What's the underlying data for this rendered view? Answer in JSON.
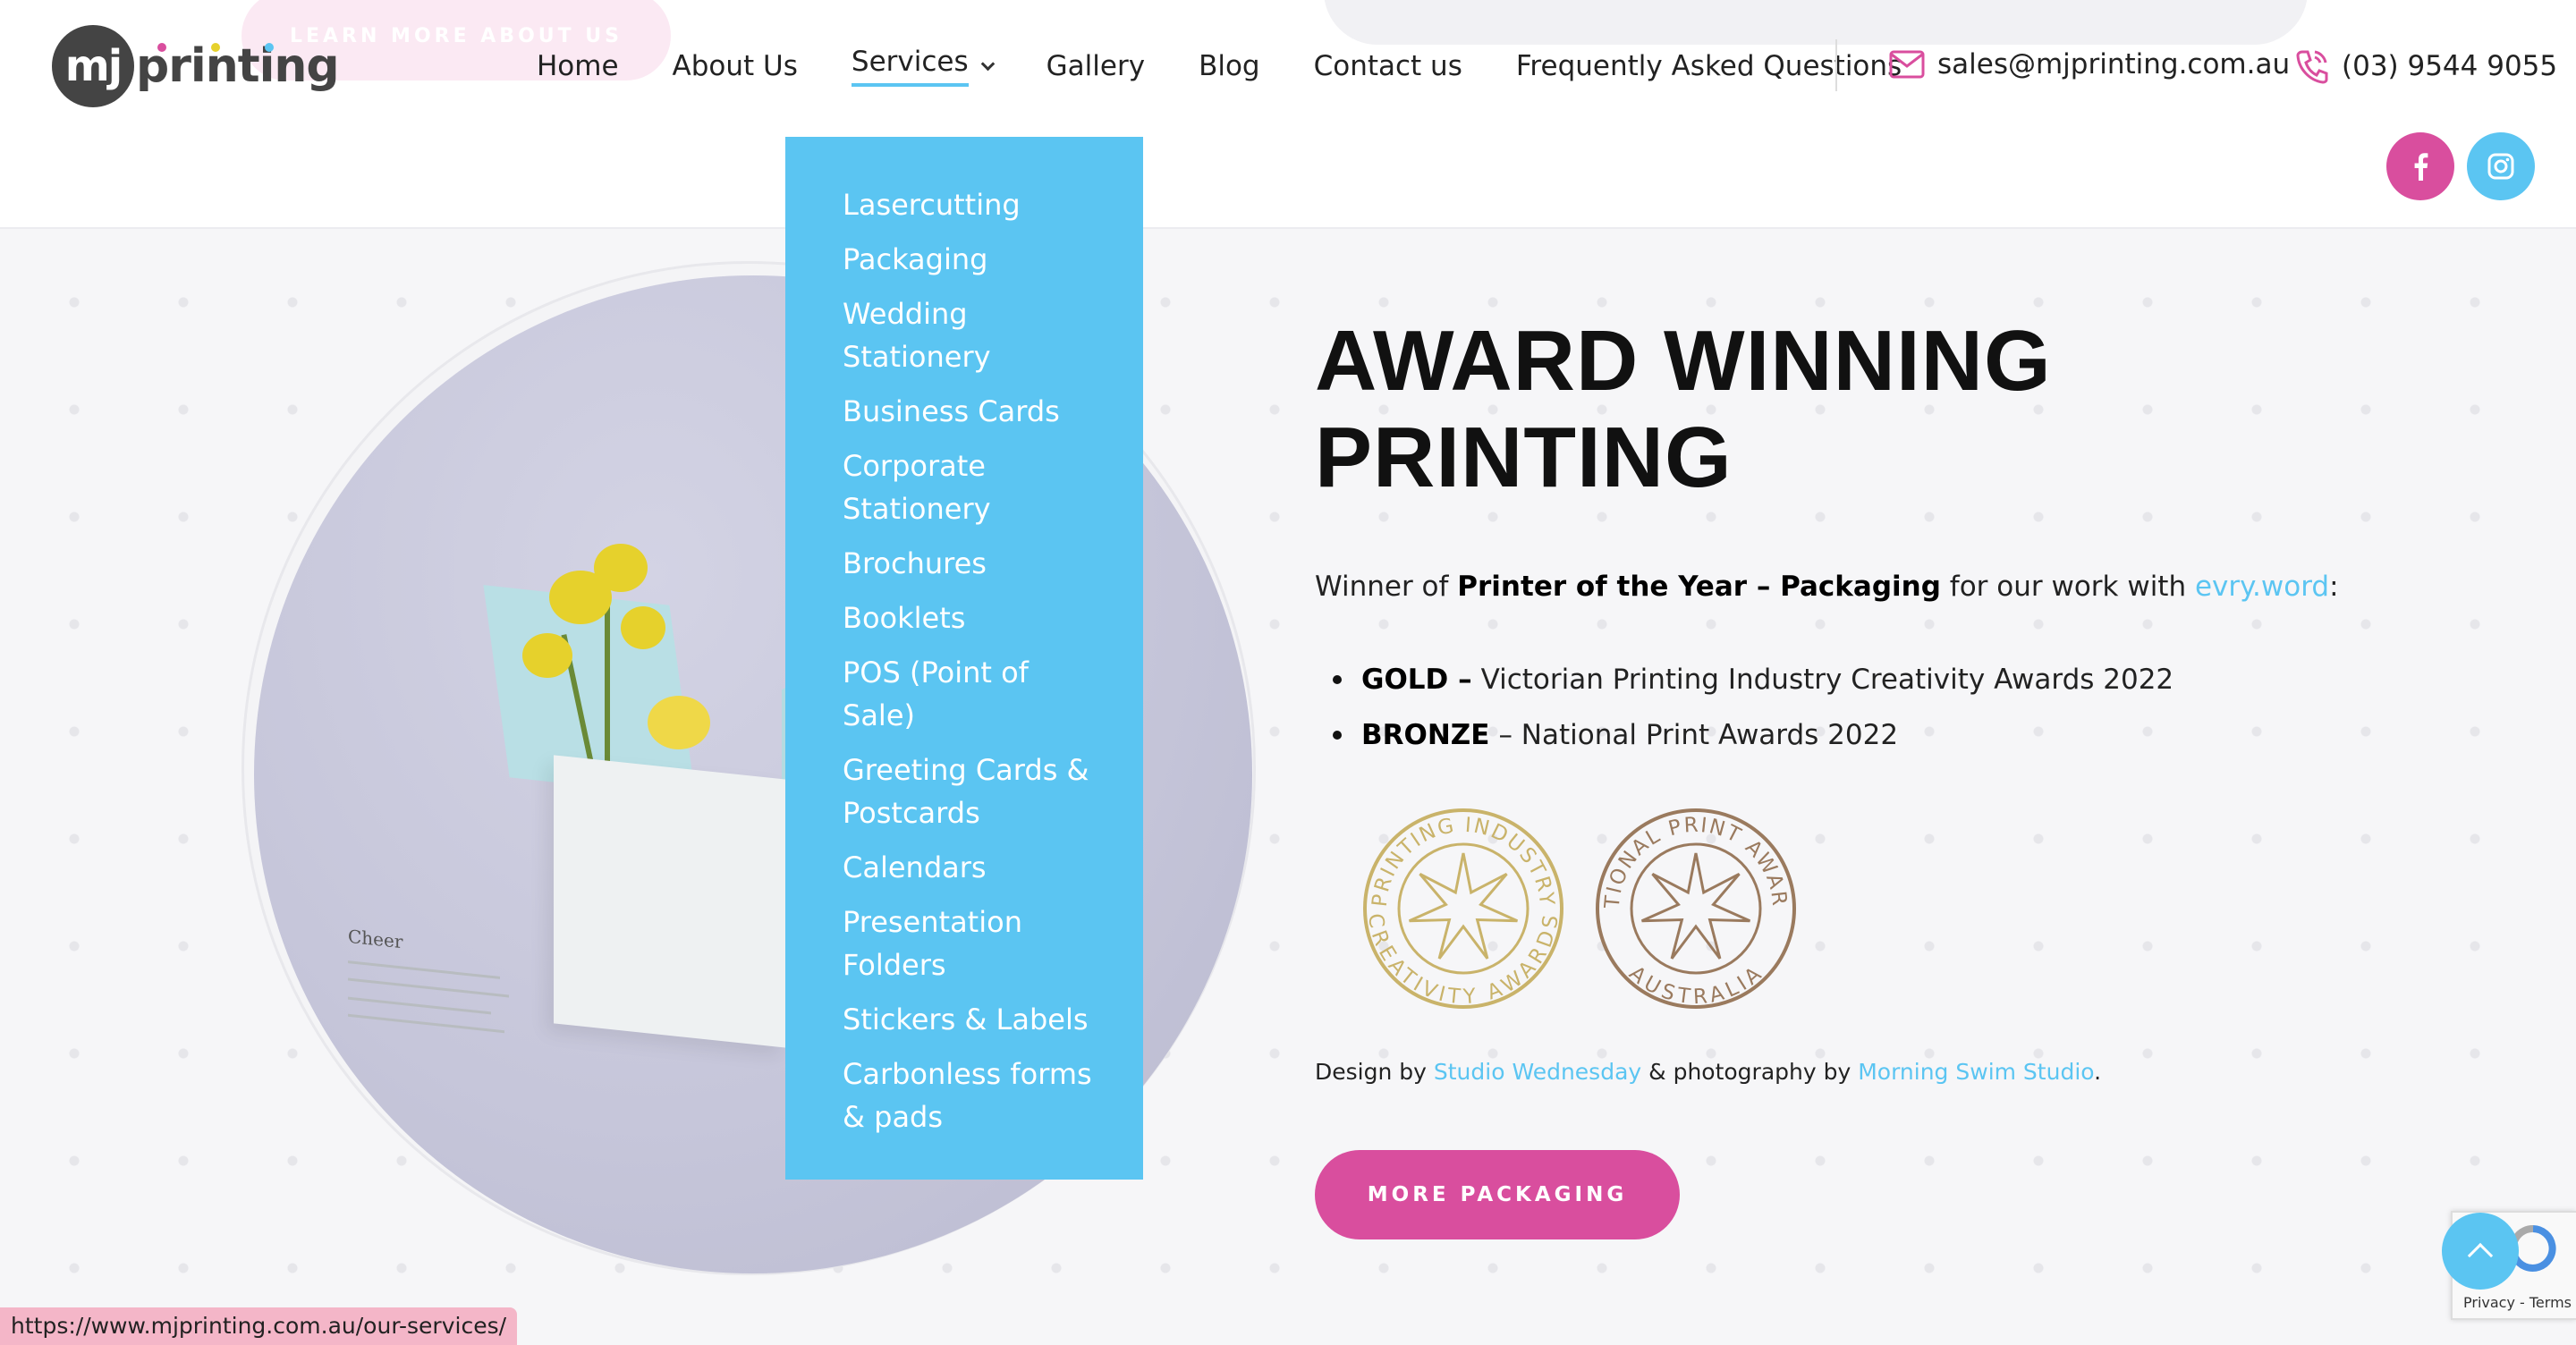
{
  "header": {
    "ghost_button_label": "LEARN MORE ABOUT US",
    "logo": {
      "mark": "mj",
      "word": "printing"
    },
    "nav": [
      {
        "label": "Home"
      },
      {
        "label": "About Us"
      },
      {
        "label": "Services",
        "active": true
      },
      {
        "label": "Gallery"
      },
      {
        "label": "Blog"
      },
      {
        "label": "Contact us"
      },
      {
        "label": "Frequently Asked Questions"
      }
    ],
    "email": {
      "icon": "envelope-icon",
      "text": "sales@mjprinting.com.au"
    },
    "phone": {
      "icon": "phone-icon",
      "text": "(03) 9544 9055"
    },
    "social": [
      {
        "icon": "facebook-icon",
        "color": "#d94e9e"
      },
      {
        "icon": "instagram-icon",
        "color": "#5bc5f2"
      }
    ]
  },
  "services_dropdown": {
    "items": [
      "Lasercutting",
      "Packaging",
      "Wedding Stationery",
      "Business Cards",
      "Corporate Stationery",
      "Brochures",
      "Booklets",
      "POS (Point of Sale)",
      "Greeting Cards & Postcards",
      "Calendars",
      "Presentation Folders",
      "Stickers & Labels",
      "Carbonless forms & pads"
    ]
  },
  "hero": {
    "box_text": "Cheer",
    "headline_line1": "AWARD WINNING",
    "headline_line2": "PRINTING",
    "winner_prefix": "Winner of ",
    "winner_bold": "Printer of the Year – Packaging",
    "winner_mid": " for our work with ",
    "winner_link": "evry.word",
    "winner_suffix": ":",
    "awards": [
      {
        "bold": "GOLD –",
        "text": "Victorian Printing Industry Creativity Awards 2022"
      },
      {
        "bold": "BRONZE",
        "text": "– National Print Awards 2022"
      }
    ],
    "seals": [
      {
        "top": "PRINTING INDUSTRY",
        "bottom": "CREATIVITY AWARDS",
        "color": "#c9b36a"
      },
      {
        "top": "NATIONAL PRINT AWARDS",
        "bottom": "AUSTRALIA",
        "color": "#9a7a5e"
      }
    ],
    "credit_prefix": "Design by ",
    "credit_link1": "Studio Wednesday",
    "credit_mid": " & photography by ",
    "credit_link2": "Morning Swim Studio",
    "credit_suffix": ".",
    "button_label": "MORE PACKAGING"
  },
  "status_url": "https://www.mjprinting.com.au/our-services/",
  "recaptcha_links": "Privacy - Terms",
  "colors": {
    "accent_blue": "#5bc5f2",
    "accent_pink": "#d94e9e",
    "logo_gray": "#444444"
  }
}
